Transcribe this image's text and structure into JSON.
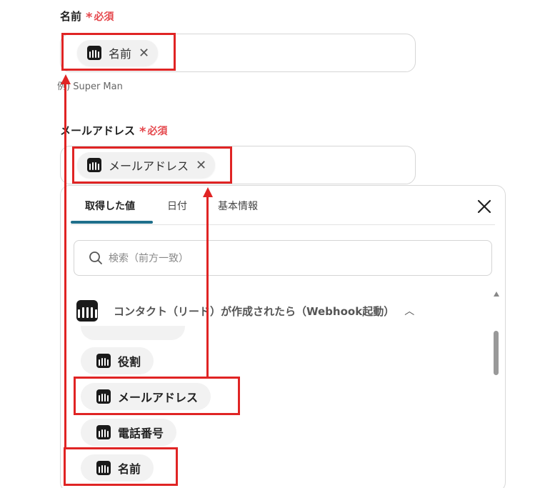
{
  "form": {
    "name_field": {
      "label": "名前",
      "required": "必須",
      "chip": "名前",
      "example": "例) Super Man"
    },
    "email_field": {
      "label": "メールアドレス",
      "required": "必須",
      "chip": "メールアドレス"
    }
  },
  "panel": {
    "tabs": [
      {
        "label": "取得した値",
        "active": true
      },
      {
        "label": "日付",
        "active": false
      },
      {
        "label": "基本情報",
        "active": false
      }
    ],
    "search_placeholder": "検索（前方一致）",
    "group_title": "コンタクト（リード）が作成されたら（Webhook起動）",
    "items": [
      "役割",
      "メールアドレス",
      "電話番号",
      "名前"
    ]
  },
  "icons": {
    "app": "intercom-icon",
    "close": "close-icon",
    "search": "search-icon",
    "chevron": "chevron-up-icon"
  },
  "colors": {
    "accent": "#1f6f8b",
    "required": "#e5484d",
    "highlight": "#e02424"
  }
}
